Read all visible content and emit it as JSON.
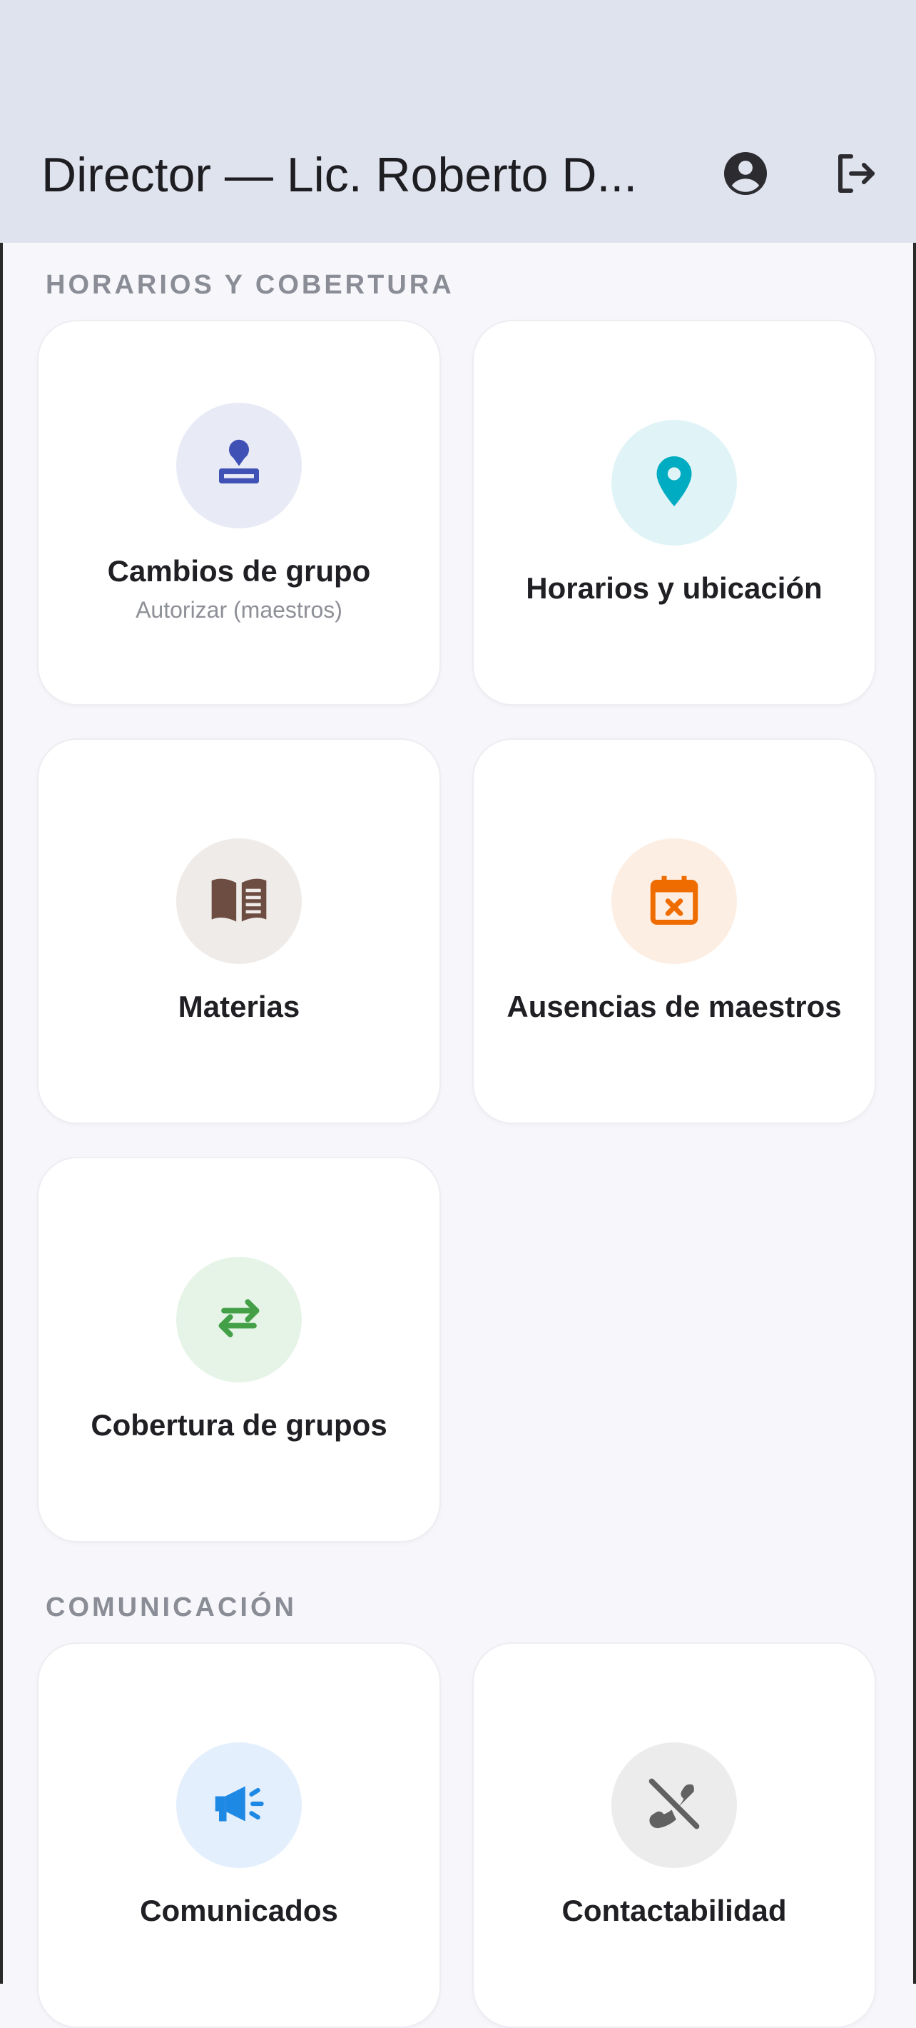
{
  "appbar": {
    "title": "Director — Lic. Roberto D...",
    "profile_icon": "account-circle-icon",
    "logout_icon": "logout-icon"
  },
  "sections": [
    {
      "header": "HORARIOS Y COBERTURA"
    },
    {
      "header": "COMUNICACIÓN"
    }
  ],
  "cards": [
    {
      "title": "Cambios de grupo",
      "subtitle": "Autorizar (maestros)",
      "icon": "stamp-icon",
      "icon_color": "#3f51b5",
      "icon_bg": "#e8eaf6"
    },
    {
      "title": "Horarios y ubicación",
      "icon": "location-pin-icon",
      "icon_color": "#00acc1",
      "icon_bg": "#e0f4f7"
    },
    {
      "title": "Materias",
      "icon": "book-icon",
      "icon_color": "#6d4c41",
      "icon_bg": "#efebe9"
    },
    {
      "title": "Ausencias de maestros",
      "icon": "calendar-cancel-icon",
      "icon_color": "#ef6c00",
      "icon_bg": "#fdeee3"
    },
    {
      "title": "Cobertura de grupos",
      "icon": "swap-arrows-icon",
      "icon_color": "#43a047",
      "icon_bg": "#e6f4e7"
    },
    {
      "title": "Comunicados",
      "icon": "megaphone-icon",
      "icon_color": "#1e88e5",
      "icon_bg": "#e3effc"
    },
    {
      "title": "Contactabilidad",
      "icon": "phone-disabled-icon",
      "icon_color": "#616161",
      "icon_bg": "#ececec"
    }
  ]
}
